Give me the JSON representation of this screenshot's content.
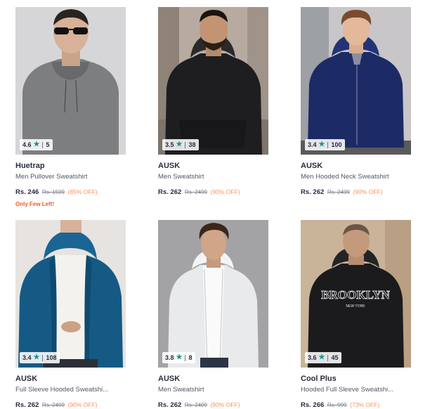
{
  "products": [
    {
      "brand": "Huetrap",
      "name": "Men Pullover Sweatshirt",
      "price": "Rs. 246",
      "mrp": "Rs. 1599",
      "discount": "(85% OFF)",
      "rating": "4.6",
      "rating_count": "5",
      "stock_note": "Only Few Left!",
      "image_description": "man in grey pullover hoodie with sunglasses"
    },
    {
      "brand": "AUSK",
      "name": "Men Sweatshirt",
      "price": "Rs. 262",
      "mrp": "Rs. 2499",
      "discount": "(90% OFF)",
      "rating": "3.5",
      "rating_count": "38",
      "stock_note": "",
      "image_description": "bearded man in black hoodie on city street"
    },
    {
      "brand": "AUSK",
      "name": "Men Hooded Neck Sweatshirt",
      "price": "Rs. 262",
      "mrp": "Rs. 2499",
      "discount": "(90% OFF)",
      "rating": "3.4",
      "rating_count": "100",
      "stock_note": "",
      "image_description": "man in navy zip-up hoodie"
    },
    {
      "brand": "AUSK",
      "name": "Full Sleeve Hooded Sweatshi...",
      "price": "Rs. 262",
      "mrp": "Rs. 2499",
      "discount": "(90% OFF)",
      "rating": "3.4",
      "rating_count": "108",
      "stock_note": "",
      "image_description": "man in teal blue open hoodie over white tee"
    },
    {
      "brand": "AUSK",
      "name": "Men Sweatshirt",
      "price": "Rs. 262",
      "mrp": "Rs. 2499",
      "discount": "(90% OFF)",
      "rating": "3.8",
      "rating_count": "8",
      "stock_note": "",
      "image_description": "man in white zip hoodie"
    },
    {
      "brand": "Cool Plus",
      "name": "Hooded Full Sleeve Sweatshi...",
      "price": "Rs. 266",
      "mrp": "Rs. 999",
      "discount": "(73% OFF)",
      "rating": "3.6",
      "rating_count": "45",
      "stock_note": "",
      "image_description": "man in black BROOKLYN NEW YORK hoodie",
      "print_text": {
        "main": "BROOKLYN",
        "sub": "NEW YORK"
      }
    }
  ],
  "colors": {
    "rating_star": "#14958f",
    "discount": "#ff905a",
    "stock_note": "#ff5722",
    "hoodies": [
      "#7c7e80",
      "#1e1e20",
      "#1c2a66",
      "#155a85",
      "#e9eaec",
      "#1b1b1d"
    ],
    "backgrounds": [
      "#d6d6d8",
      "#b7aaa0",
      "#c8c6c8",
      "#e6e3e0",
      "#a3a3a5",
      "#c9b49a"
    ]
  },
  "icons": {
    "rating": "star-icon"
  }
}
